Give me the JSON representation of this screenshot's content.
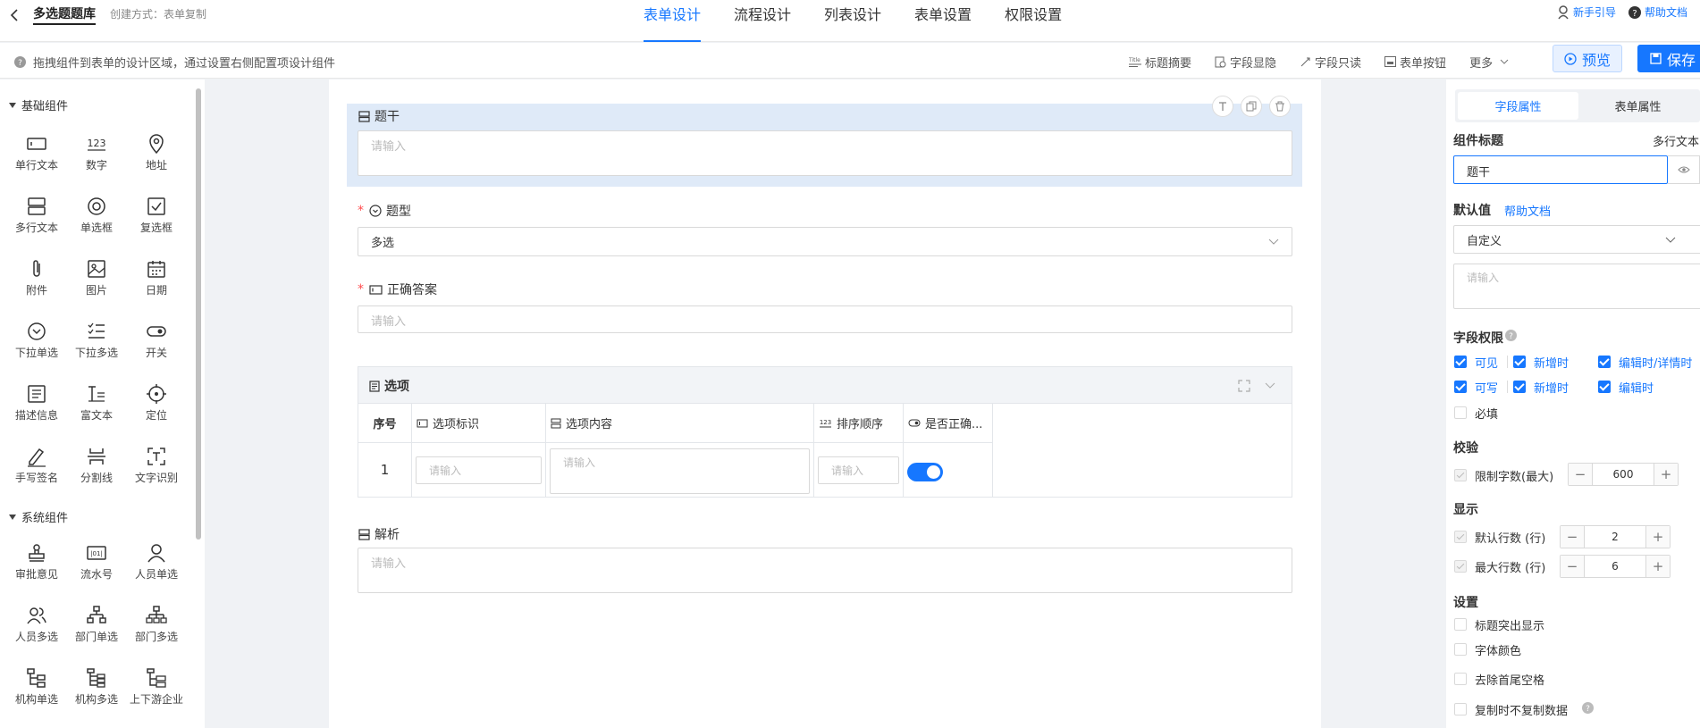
{
  "header": {
    "app_name": "多选题题库",
    "create_mode": "创建方式：表单复制",
    "tabs": [
      {
        "label": "表单设计",
        "active": true
      },
      {
        "label": "流程设计"
      },
      {
        "label": "列表设计"
      },
      {
        "label": "表单设置"
      },
      {
        "label": "权限设置"
      }
    ],
    "guide_link": "新手引导",
    "help_link": "帮助文档"
  },
  "toolbar": {
    "hint": "拖拽组件到表单的设计区域，通过设置右侧配置项设计组件",
    "tools": [
      "标题摘要",
      "字段显隐",
      "字段只读",
      "表单按钮"
    ],
    "more_label": "更多",
    "preview_label": "预览",
    "save_label": "保存"
  },
  "sidebar": {
    "basic_title": "基础组件",
    "basic_items": [
      {
        "label": "单行文本",
        "icon": "single-line-text-icon"
      },
      {
        "label": "数字",
        "icon": "number-icon"
      },
      {
        "label": "地址",
        "icon": "location-pin-icon"
      },
      {
        "label": "多行文本",
        "icon": "multi-line-text-icon"
      },
      {
        "label": "单选框",
        "icon": "radio-icon"
      },
      {
        "label": "复选框",
        "icon": "checkbox-icon"
      },
      {
        "label": "附件",
        "icon": "paperclip-icon"
      },
      {
        "label": "图片",
        "icon": "image-icon"
      },
      {
        "label": "日期",
        "icon": "calendar-icon"
      },
      {
        "label": "下拉单选",
        "icon": "dropdown-icon"
      },
      {
        "label": "下拉多选",
        "icon": "checklist-icon"
      },
      {
        "label": "开关",
        "icon": "toggle-icon"
      },
      {
        "label": "描述信息",
        "icon": "description-icon"
      },
      {
        "label": "富文本",
        "icon": "rich-text-icon"
      },
      {
        "label": "定位",
        "icon": "crosshair-icon"
      },
      {
        "label": "手写签名",
        "icon": "pen-icon"
      },
      {
        "label": "分割线",
        "icon": "divider-icon"
      },
      {
        "label": "文字识别",
        "icon": "ocr-icon"
      }
    ],
    "system_title": "系统组件",
    "system_items": [
      {
        "label": "审批意见",
        "icon": "stamp-icon"
      },
      {
        "label": "流水号",
        "icon": "serial-number-icon"
      },
      {
        "label": "人员单选",
        "icon": "person-icon"
      },
      {
        "label": "人员多选",
        "icon": "people-icon"
      },
      {
        "label": "部门单选",
        "icon": "org-tree-icon"
      },
      {
        "label": "部门多选",
        "icon": "org-tree-multi-icon"
      },
      {
        "label": "机构单选",
        "icon": "org-branch-icon"
      },
      {
        "label": "机构多选",
        "icon": "org-branch-multi-icon"
      },
      {
        "label": "上下游企业",
        "icon": "enterprise-chain-icon"
      }
    ]
  },
  "form": {
    "stem_label": "题干",
    "stem_placeholder": "请输入",
    "type_label": "题型",
    "type_value": "多选",
    "answer_label": "正确答案",
    "answer_placeholder": "请输入",
    "options_title": "选项",
    "columns": [
      "序号",
      "选项标识",
      "选项内容",
      "排序顺序",
      "是否正确..."
    ],
    "row_index": "1",
    "row_placeholder": "请输入",
    "row_correct": true,
    "analysis_label": "解析",
    "analysis_placeholder": "请输入"
  },
  "props": {
    "tab_field": "字段属性",
    "tab_form": "表单属性",
    "title_label": "组件标题",
    "type_name": "多行文本",
    "title_value": "题干",
    "default_label": "默认值",
    "help_link": "帮助文档",
    "default_select": "自定义",
    "default_placeholder": "请输入",
    "perm_title": "字段权限",
    "perm_visible": "可见",
    "perm_writable": "可写",
    "perm_new": "新增时",
    "perm_edit_detail": "编辑时/详情时",
    "perm_edit": "编辑时",
    "required_label": "必填",
    "validate_title": "校验",
    "limit_label": "限制字数(最大)",
    "limit_value": "600",
    "display_title": "显示",
    "default_rows_label": "默认行数 (行)",
    "default_rows_value": "2",
    "max_rows_label": "最大行数 (行)",
    "max_rows_value": "6",
    "settings_title": "设置",
    "setting_items": [
      "标题突出显示",
      "字体颜色",
      "去除首尾空格",
      "复制时不复制数据"
    ]
  },
  "colors": {
    "accent": "#1677ff",
    "selected_bg": "#dfeaf8",
    "required": "#ff4d4f"
  }
}
